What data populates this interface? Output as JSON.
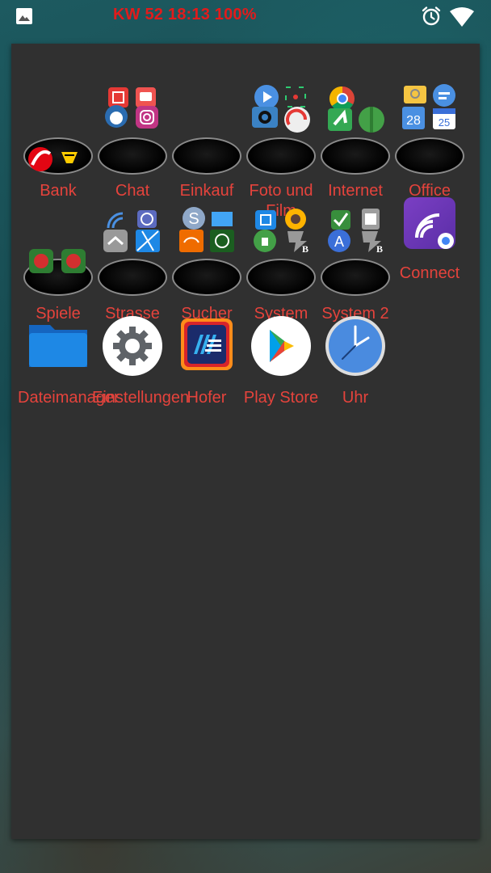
{
  "status_bar": {
    "text": "KW 52 18:13 100%",
    "text_color": "#e21b1b",
    "left_icon": "image-icon",
    "right_icons": [
      "alarm-icon",
      "wifi-icon"
    ]
  },
  "drawer": {
    "background": "#303030",
    "label_color": "#e5433c",
    "apps": [
      {
        "id": "bank",
        "label": "Bank",
        "type": "folder"
      },
      {
        "id": "chat",
        "label": "Chat",
        "type": "folder"
      },
      {
        "id": "einkauf",
        "label": "Einkauf",
        "type": "folder"
      },
      {
        "id": "foto",
        "label": "Foto und Film",
        "type": "folder"
      },
      {
        "id": "internet",
        "label": "Internet",
        "type": "folder"
      },
      {
        "id": "office",
        "label": "Office",
        "type": "folder"
      },
      {
        "id": "spiele",
        "label": "Spiele",
        "type": "folder"
      },
      {
        "id": "strasse",
        "label": "Strasse",
        "type": "folder"
      },
      {
        "id": "sucher",
        "label": "Sucher",
        "type": "folder"
      },
      {
        "id": "system",
        "label": "System",
        "type": "folder"
      },
      {
        "id": "system2",
        "label": "System 2",
        "type": "folder"
      },
      {
        "id": "connect",
        "label": "Connect",
        "type": "app"
      },
      {
        "id": "dateimanager",
        "label": "Dateimanager",
        "type": "app"
      },
      {
        "id": "einstellungen",
        "label": "Einstellungen",
        "type": "app"
      },
      {
        "id": "hofer",
        "label": "Hofer",
        "type": "app"
      },
      {
        "id": "playstore",
        "label": "Play Store",
        "type": "app"
      },
      {
        "id": "uhr",
        "label": "Uhr",
        "type": "app"
      }
    ]
  }
}
